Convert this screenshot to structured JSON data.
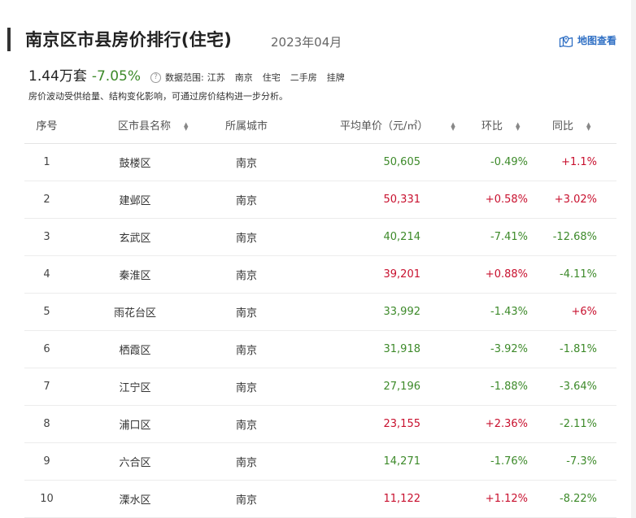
{
  "header": {
    "title": "南京区市县房价排行(住宅)",
    "period": "2023年04月",
    "map_link": "地图查看"
  },
  "summary": {
    "total": "1.44万套",
    "change": "-7.05%",
    "scope_label": "数据范围:",
    "scope_tags": [
      "江苏",
      "南京",
      "住宅",
      "二手房",
      "挂牌"
    ],
    "note": "房价波动受供给量、结构变化影响，可通过房价结构进一步分析。"
  },
  "table": {
    "headers": [
      "序号",
      "区市县名称",
      "所属城市",
      "平均单价（元/㎡）",
      "环比",
      "同比"
    ],
    "rows": [
      {
        "rank": "1",
        "district": "鼓楼区",
        "city": "南京",
        "price": "50,605",
        "mom": "-0.49%",
        "yoy": "+1.1%"
      },
      {
        "rank": "2",
        "district": "建邺区",
        "city": "南京",
        "price": "50,331",
        "mom": "+0.58%",
        "yoy": "+3.02%"
      },
      {
        "rank": "3",
        "district": "玄武区",
        "city": "南京",
        "price": "40,214",
        "mom": "-7.41%",
        "yoy": "-12.68%"
      },
      {
        "rank": "4",
        "district": "秦淮区",
        "city": "南京",
        "price": "39,201",
        "mom": "+0.88%",
        "yoy": "-4.11%"
      },
      {
        "rank": "5",
        "district": "雨花台区",
        "city": "南京",
        "price": "33,992",
        "mom": "-1.43%",
        "yoy": "+6%"
      },
      {
        "rank": "6",
        "district": "栖霞区",
        "city": "南京",
        "price": "31,918",
        "mom": "-3.92%",
        "yoy": "-1.81%"
      },
      {
        "rank": "7",
        "district": "江宁区",
        "city": "南京",
        "price": "27,196",
        "mom": "-1.88%",
        "yoy": "-3.64%"
      },
      {
        "rank": "8",
        "district": "浦口区",
        "city": "南京",
        "price": "23,155",
        "mom": "+2.36%",
        "yoy": "-2.11%"
      },
      {
        "rank": "9",
        "district": "六合区",
        "city": "南京",
        "price": "14,271",
        "mom": "-1.76%",
        "yoy": "-7.3%"
      },
      {
        "rank": "10",
        "district": "溧水区",
        "city": "南京",
        "price": "11,122",
        "mom": "+1.12%",
        "yoy": "-8.22%"
      }
    ]
  },
  "icons": {
    "help": "help-circle-icon",
    "map": "map-pin-icon",
    "sort": "sort-arrows-icon"
  },
  "colors": {
    "up": "#c8102e",
    "down": "#3d8a2a",
    "link": "#2f6fc4"
  }
}
